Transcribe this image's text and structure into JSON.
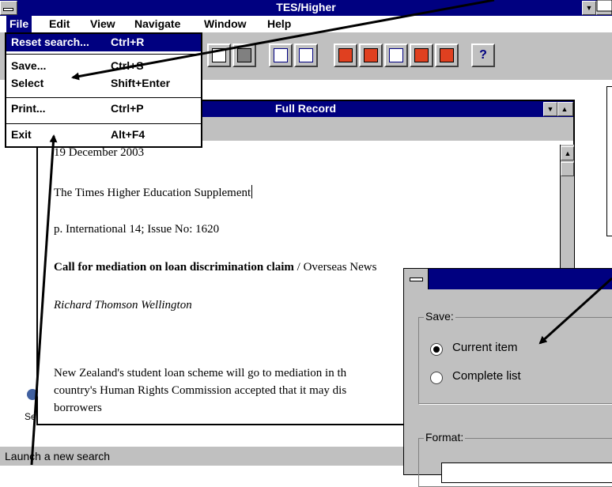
{
  "app": {
    "title": "TES/Higher"
  },
  "menubar": {
    "items": [
      "File",
      "Edit",
      "View",
      "Navigate",
      "Window",
      "Help"
    ]
  },
  "file_menu": {
    "items": [
      {
        "label": "Reset search...",
        "shortcut": "Ctrl+R",
        "selected": true
      },
      {
        "label": "Save...",
        "shortcut": "Ctrl+S"
      },
      {
        "label": "Select",
        "shortcut": "Shift+Enter"
      },
      {
        "label": "Print...",
        "shortcut": "Ctrl+P"
      },
      {
        "label": "Exit",
        "shortcut": "Alt+F4"
      }
    ]
  },
  "record_window": {
    "title": "Full Record",
    "lines": {
      "date": "19 December 2003",
      "source": "The Times Higher Education Supplement",
      "page": "p. International 14; Issue No: 1620",
      "headline": "Call for mediation on loan discrimination claim",
      "section": " / Overseas News",
      "author": "Richard Thomson Wellington",
      "body1": "New Zealand's student loan scheme will go to mediation in th",
      "body2": "country's Human Rights Commission accepted that it may dis",
      "body3": "borrowers"
    }
  },
  "desktop_label": "Se",
  "status": {
    "text": "Launch a new search"
  },
  "save_dialog": {
    "save_group": "Save:",
    "option_current": "Current item",
    "option_complete": "Complete list",
    "format_group": "Format:"
  },
  "colors": {
    "titlebar": "#000080",
    "chrome": "#c0c0c0"
  }
}
